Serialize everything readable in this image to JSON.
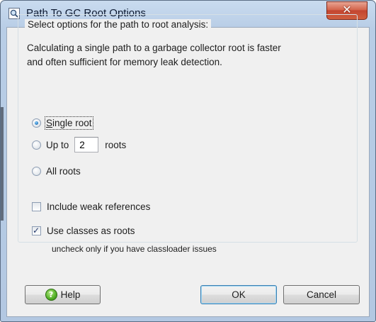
{
  "window": {
    "title": "Path To GC Root Options",
    "close_glyph": "✕"
  },
  "options": {
    "group_legend": "Select options for the path to root analysis:",
    "description_line1": "Calculating a single path to a garbage collector root is faster",
    "description_line2": "and often sufficient for memory leak detection.",
    "radio_single": {
      "label": "Single root",
      "selected": true
    },
    "radio_upto": {
      "label_before": "Up to",
      "value": "2",
      "label_after": "roots",
      "selected": false
    },
    "radio_all": {
      "label": "All roots",
      "selected": false
    },
    "check_weak": {
      "label": "Include weak references",
      "checked": false
    },
    "check_classes": {
      "label": "Use classes as roots",
      "checked": true
    },
    "hint": "uncheck only if you have classloader issues"
  },
  "buttons": {
    "help": "Help",
    "help_icon": "?",
    "ok": "OK",
    "cancel": "Cancel"
  },
  "colors": {
    "frame": "#b8cde6",
    "client_bg": "#f0f0f0",
    "close_button": "#c94a35",
    "help_icon_green": "#58b42b"
  },
  "icons": {
    "title": "magnifier-icon",
    "help": "help-circle-icon",
    "close": "close-icon"
  }
}
